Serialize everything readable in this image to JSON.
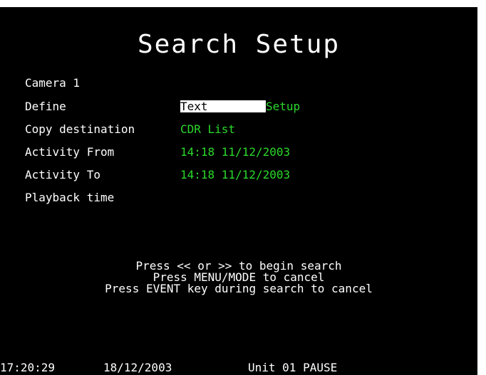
{
  "title": "Search Setup",
  "labels": {
    "camera": "Camera 1",
    "define": "Define",
    "copy_destination": "Copy destination",
    "activity_from": "Activity From",
    "activity_to": "Activity To",
    "playback_time": "Playback time"
  },
  "values": {
    "define_selected": "Text",
    "define_option": "Setup",
    "copy_destination": "CDR List",
    "activity_from": "14:18 11/12/2003",
    "activity_to": "14:18 11/12/2003"
  },
  "messages": [
    "Press << or >> to begin search",
    "Press MENU/MODE to cancel",
    "Press EVENT key during search to cancel"
  ],
  "status": {
    "time": "17:20:29",
    "date": "18/12/2003",
    "unit": "Unit 01 PAUSE"
  },
  "colors": {
    "background": "#000000",
    "text": "#ffffff",
    "value": "#2bd82b"
  }
}
